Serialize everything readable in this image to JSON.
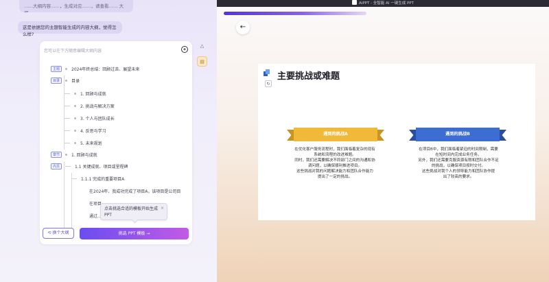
{
  "titlebar": {
    "text": "AiPPT - 全智能 AI 一键生成 PPT"
  },
  "chat": {
    "bubble_partial": "……大纲内容……，生成对应……，请查看…… 大纲……",
    "bubble_main": "这是依据您的主题智能生成的内容大纲，觉得怎么样?"
  },
  "outline_card": {
    "hint": "您可以在下方随意编辑大纲内容",
    "rows": [
      {
        "tag": "主题",
        "text": "2024年终总结：回顾过去、展望未来"
      },
      {
        "tag": "目录",
        "text": "目录"
      },
      {
        "tag": "",
        "text": "1. 回顾与成就"
      },
      {
        "tag": "",
        "text": "2. 挑战与解决方案"
      },
      {
        "tag": "",
        "text": "3. 个人与团队成长"
      },
      {
        "tag": "",
        "text": "4. 反思与学习"
      },
      {
        "tag": "",
        "text": "5. 未来规划"
      },
      {
        "tag": "章节",
        "text": "1. 回顾与成就"
      },
      {
        "tag": "内页",
        "text": "1.1 关键成就、项目或里程碑"
      },
      {
        "tag": "",
        "text": "1.1.1 完成的重要项目A"
      },
      {
        "tag": "",
        "text": "在2024年、我成功完成了项目A，该项目是公司目"
      },
      {
        "tag": "",
        "text": "在项目…"
      },
      {
        "tag": "",
        "text": "通过…"
      }
    ],
    "tooltip": "点击挑选合适的模板开始生成PPT",
    "tooltip_close": "×",
    "change_button": "换个大纲",
    "pick_button": "挑选 PPT 模板 →"
  },
  "slide": {
    "title": "主要挑战或难题",
    "challengeA": {
      "heading": "遇到的挑战A",
      "lines": [
        "在优化客户服务流程时，我们面临着复杂的现有",
        "系统和流程的改进难题。",
        "同时，我们还需要解决不同部门之间的沟通和协",
        "调问题，以确保顺利推进项目。",
        "这些挑战对我的问题解决能力和团队合作能力",
        "提出了一定的挑战。"
      ]
    },
    "challengeB": {
      "heading": "遇到的挑战B",
      "lines": [
        "在项目B中，我们面临着紧迫的时间限制，需要",
        "在短时间内完成业务任务。",
        "另外，我们还需要克服资源有限和团队合作不足",
        "的挑战，以确保项目按时交付。",
        "这些挑战对我个人的领导能力和团队协作提",
        "出了较高的要求。"
      ]
    }
  },
  "colors": {
    "accent": "#6a4df0",
    "bannerA": "#f1b93a",
    "bannerB": "#3d6cd2"
  }
}
